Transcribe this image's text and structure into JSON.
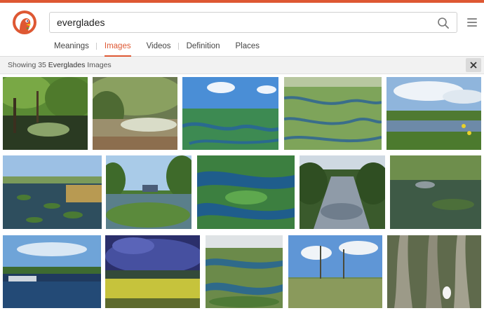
{
  "search": {
    "query": "everglades"
  },
  "tabs": [
    {
      "label": "Meanings"
    },
    {
      "label": "Images"
    },
    {
      "label": "Videos"
    },
    {
      "label": "Definition"
    },
    {
      "label": "Places"
    }
  ],
  "results": {
    "prefix": "Showing 35 ",
    "query": "Everglades",
    "suffix": " Images",
    "count": 35
  },
  "colors": {
    "accent": "#de5833"
  },
  "icons": {
    "search": "search-icon",
    "menu": "menu-icon",
    "close": "close-icon",
    "logo": "duckduckgo-logo"
  }
}
